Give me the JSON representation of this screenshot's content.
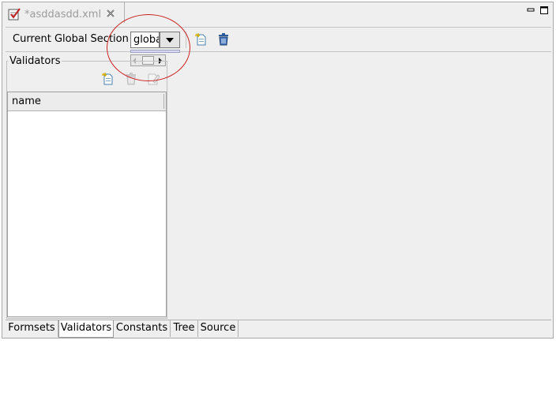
{
  "editor": {
    "tab_title": "*asddasdd.xml",
    "close_icon": "close-x-icon",
    "file_icon": "edit-document-icon"
  },
  "window_controls": {
    "minimize_icon": "minimize-icon",
    "maximize_icon": "maximize-icon"
  },
  "global_section": {
    "label": "Current Global Section",
    "combo_value": "global",
    "add_icon": "new-document-icon",
    "delete_icon": "trash-icon"
  },
  "validators": {
    "group_label": "Validators",
    "add_icon": "new-document-icon",
    "delete_icon": "trash-icon-disabled",
    "edit_icon": "edit-icon-disabled",
    "columns": [
      "name"
    ],
    "rows": []
  },
  "bottom_tabs": [
    {
      "label": "Formsets",
      "active": false
    },
    {
      "label": "Validators",
      "active": true
    },
    {
      "label": "Constants",
      "active": false
    },
    {
      "label": "Tree",
      "active": false
    },
    {
      "label": "Source",
      "active": false
    }
  ],
  "colors": {
    "annotation": "#cc2020",
    "panel_bg": "#efefef",
    "tab_inactive_text": "#9c9c9c"
  }
}
